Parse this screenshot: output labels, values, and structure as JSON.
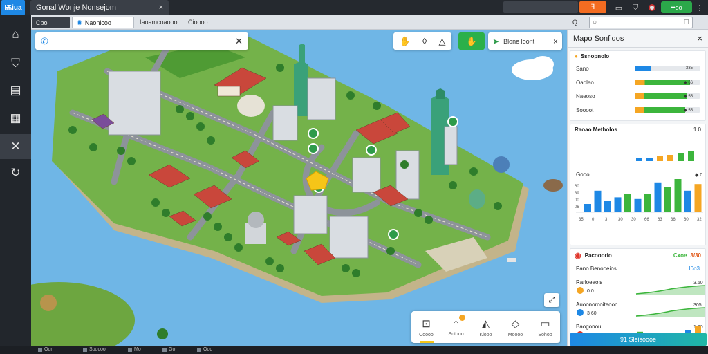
{
  "topbar": {
    "logo": "Ѭiua",
    "window_title": "Gonal Wonje Nonsejom",
    "close": "×",
    "orange_btn": "ꟻ",
    "green_btn": "••oo"
  },
  "secondbar": {
    "tab_group": "Cbo",
    "active_tab": "Naonlcoo",
    "items": [
      "Iaoamcoaooo",
      "Cioooo"
    ],
    "search_placeholder": ""
  },
  "sidebar": {
    "items": [
      "map-pin-icon",
      "shield-icon",
      "list-icon",
      "book-icon",
      "tools-icon",
      "help-icon"
    ],
    "active_index": 4
  },
  "map": {
    "search_placeholder": "",
    "info_label": "Blone loont",
    "info_close": "×",
    "actions": [
      {
        "icon": "grid-select-icon",
        "label": "Coooo"
      },
      {
        "icon": "build-icon",
        "label": "Sntooo"
      },
      {
        "icon": "terrain-icon",
        "label": "Kiooo"
      },
      {
        "icon": "tag-icon",
        "label": "Moooo"
      },
      {
        "icon": "frame-icon",
        "label": "Sohoo"
      }
    ]
  },
  "panel": {
    "title": "Mapo Sonfiqos",
    "close": "×",
    "stats_title": "Ssnopnolo",
    "stats": [
      {
        "name": "Sano",
        "value": "335",
        "fill": 0.26,
        "color": "#1e88e5"
      },
      {
        "name": "Oaoleo",
        "value": "◆ 66",
        "fill": 0.85,
        "color": "#3cb53c"
      },
      {
        "name": "Naeoso",
        "value": "◆ 55",
        "fill": 0.8,
        "color": "#3cb53c"
      },
      {
        "name": "Soooot",
        "value": "◆ 55",
        "fill": 0.78,
        "color": "#3cb53c"
      }
    ],
    "metrics_title": "Raoao Metholos",
    "metrics_value": "1 0",
    "bar_chart_label": "Gooo",
    "bar_chart_value": "◆ 0",
    "bar_chart_labels": [
      "60",
      "39",
      "00",
      "06"
    ],
    "bar_chart_ticks": [
      "35",
      "0",
      "3",
      "30",
      "30",
      "66",
      "63",
      "36",
      "60",
      "32"
    ],
    "reports_title": "Pacooorio",
    "reports_value_a": "Cxoe",
    "reports_value_b": "3/30",
    "rows": [
      {
        "label": "Pano Benooeios",
        "value": "Ι0ο3",
        "sub": ""
      },
      {
        "label": "Rarloeaols",
        "value": "3.50",
        "sub": "0   0"
      },
      {
        "label": "Auoonorcoiteoon",
        "value": "305",
        "sub": "3   60"
      },
      {
        "label": "Baogonoui",
        "value": "1.00",
        "sub": "36   35"
      }
    ],
    "cta": "91 Sleisoooe"
  },
  "bottombar": {
    "items": [
      "Oon",
      "Soocoo",
      "Mo",
      "Go",
      "Ooo"
    ]
  },
  "colors": {
    "accent": "#1e88e5",
    "green": "#3cb53c",
    "orange": "#f36c21",
    "water": "#6fb6e6",
    "grass": "#74b24a"
  }
}
